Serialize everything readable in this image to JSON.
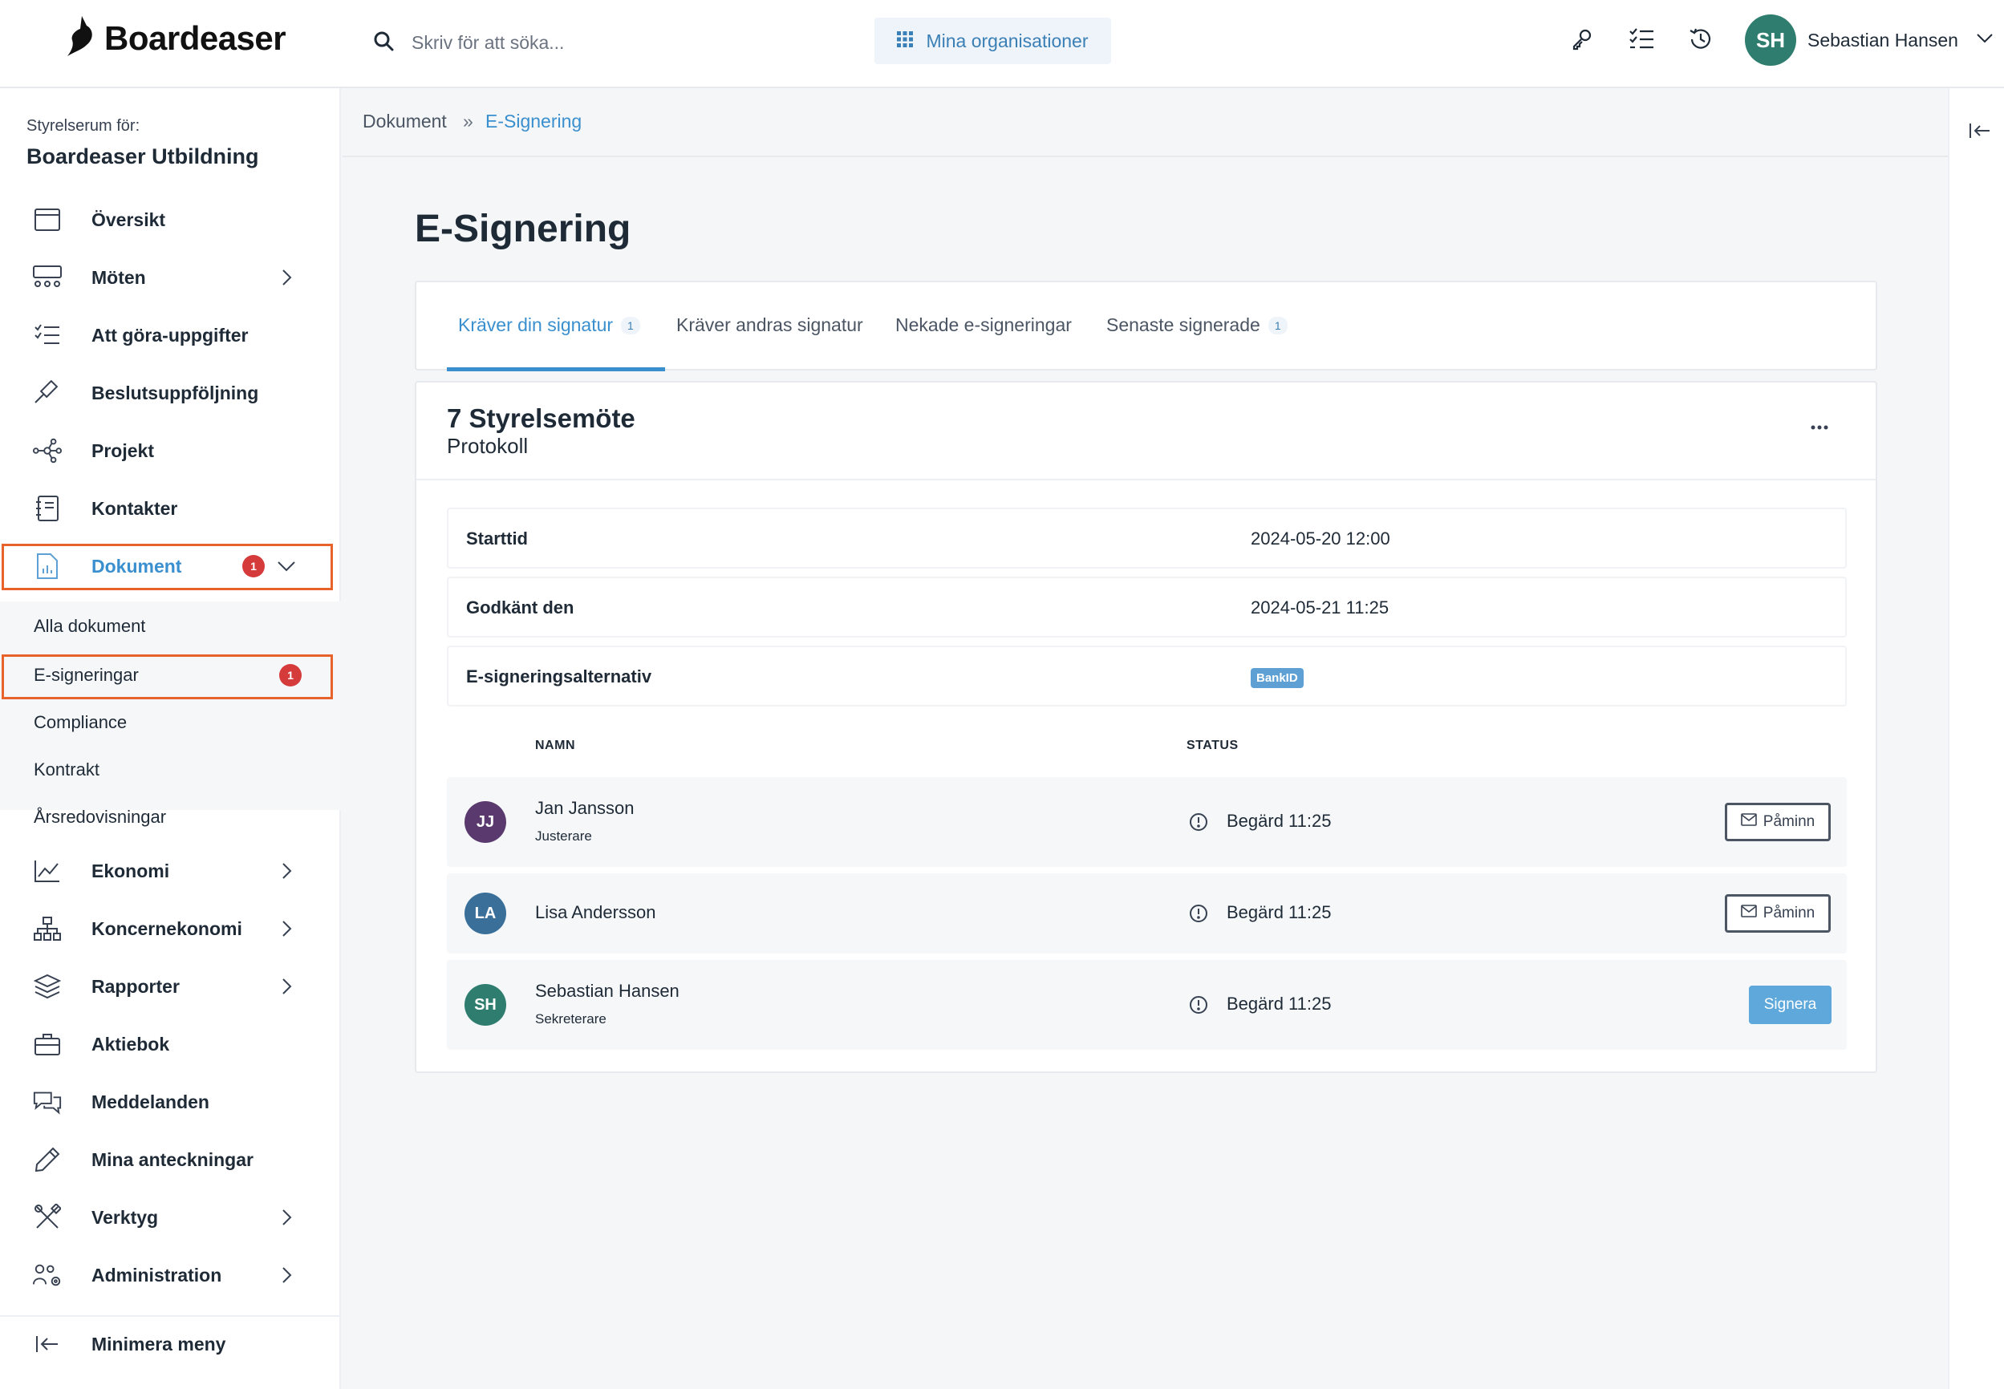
{
  "app": {
    "brand": "Boardeaser"
  },
  "search": {
    "placeholder": "Skriv för att söka..."
  },
  "header": {
    "org_button": "Mina organisationer"
  },
  "user": {
    "initials": "SH",
    "name": "Sebastian Hansen"
  },
  "sidebar": {
    "org_label": "Styrelserum för:",
    "org_name": "Boardeaser Utbildning",
    "items": [
      {
        "label": "Översikt"
      },
      {
        "label": "Möten"
      },
      {
        "label": "Att göra-uppgifter"
      },
      {
        "label": "Beslutsuppföljning"
      },
      {
        "label": "Projekt"
      },
      {
        "label": "Kontakter"
      },
      {
        "label": "Dokument",
        "badge": "1"
      },
      {
        "label": "Ekonomi"
      },
      {
        "label": "Koncernekonomi"
      },
      {
        "label": "Rapporter"
      },
      {
        "label": "Aktiebok"
      },
      {
        "label": "Meddelanden"
      },
      {
        "label": "Mina anteckningar"
      },
      {
        "label": "Verktyg"
      },
      {
        "label": "Administration"
      }
    ],
    "sub_items": [
      {
        "label": "Alla dokument"
      },
      {
        "label": "E-signeringar",
        "badge": "1"
      },
      {
        "label": "Compliance"
      },
      {
        "label": "Kontrakt"
      },
      {
        "label": "Årsredovisningar"
      }
    ],
    "minimize": "Minimera meny"
  },
  "breadcrumb": {
    "parent": "Dokument",
    "separator": "»",
    "current": "E-Signering"
  },
  "page": {
    "title": "E-Signering"
  },
  "tabs": [
    {
      "label": "Kräver din signatur",
      "count": "1"
    },
    {
      "label": "Kräver andras signatur"
    },
    {
      "label": "Nekade e-signeringar"
    },
    {
      "label": "Senaste signerade",
      "count": "1"
    }
  ],
  "document": {
    "title": "7 Styrelsemöte",
    "subtitle": "Protokoll",
    "info": [
      {
        "label": "Starttid",
        "value": "2024-05-20 12:00"
      },
      {
        "label": "Godkänt den",
        "value": "2024-05-21 11:25"
      },
      {
        "label": "E-signeringsalternativ",
        "value": "BankID"
      }
    ],
    "columns": {
      "name": "NAMN",
      "status": "STATUS"
    },
    "signers": [
      {
        "initials": "JJ",
        "name": "Jan Jansson",
        "role": "Justerare",
        "status": "Begärd 11:25",
        "action": "Påminn",
        "color": "#5a3a6e"
      },
      {
        "initials": "LA",
        "name": "Lisa Andersson",
        "role": "",
        "status": "Begärd 11:25",
        "action": "Påminn",
        "color": "#3a6f9a"
      },
      {
        "initials": "SH",
        "name": "Sebastian Hansen",
        "role": "Sekreterare",
        "status": "Begärd 11:25",
        "action": "Signera",
        "color": "#2e7d6e"
      }
    ]
  }
}
